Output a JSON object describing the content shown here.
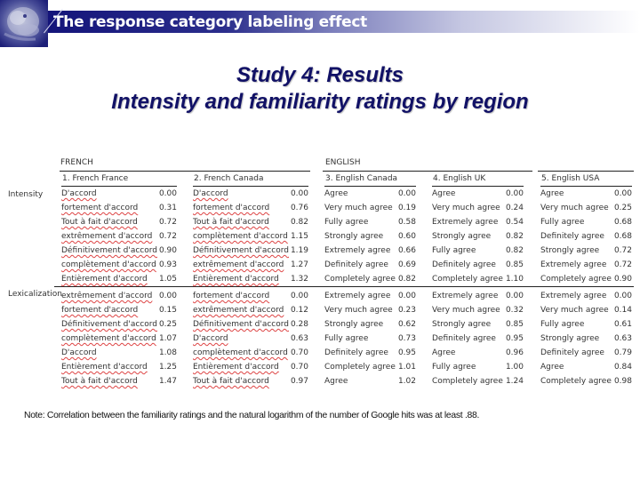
{
  "header": {
    "title": "The response category labeling effect",
    "logo_icon": "lion-icon"
  },
  "slide": {
    "title_line1": "Study 4: Results",
    "title_line2": "Intensity and familiarity ratings by region"
  },
  "table": {
    "groups": [
      {
        "label": "FRENCH"
      },
      {
        "label": "ENGLISH"
      },
      {
        "label": ""
      }
    ],
    "sections": [
      "Intensity",
      "Lexicalization"
    ],
    "columns": [
      {
        "header": "1. French France",
        "intensity": [
          {
            "label": "D'accord",
            "value": "0.00"
          },
          {
            "label": "fortement d'accord",
            "value": "0.31"
          },
          {
            "label": "Tout à fait d'accord",
            "value": "0.72"
          },
          {
            "label": "extrêmement d'accord",
            "value": "0.72"
          },
          {
            "label": "Définitivement d'accord",
            "value": "0.90"
          },
          {
            "label": "complètement d'accord",
            "value": "0.93"
          },
          {
            "label": "Entièrement d'accord",
            "value": "1.05"
          }
        ],
        "lexicalization": [
          {
            "label": "extrêmement d'accord",
            "value": "0.00"
          },
          {
            "label": "fortement d'accord",
            "value": "0.15"
          },
          {
            "label": "Définitivement d'accord",
            "value": "0.25"
          },
          {
            "label": "complètement d'accord",
            "value": "1.07"
          },
          {
            "label": "D'accord",
            "value": "1.08"
          },
          {
            "label": "Entièrement d'accord",
            "value": "1.25"
          },
          {
            "label": "Tout à fait d'accord",
            "value": "1.47"
          }
        ]
      },
      {
        "header": "2. French Canada",
        "intensity": [
          {
            "label": "D'accord",
            "value": "0.00"
          },
          {
            "label": "fortement d'accord",
            "value": "0.76"
          },
          {
            "label": "Tout à fait d'accord",
            "value": "0.82"
          },
          {
            "label": "complètement d'accord",
            "value": "1.15"
          },
          {
            "label": "Définitivement d'accord",
            "value": "1.19"
          },
          {
            "label": "extrêmement d'accord",
            "value": "1.27"
          },
          {
            "label": "Entièrement d'accord",
            "value": "1.32"
          }
        ],
        "lexicalization": [
          {
            "label": "fortement d'accord",
            "value": "0.00"
          },
          {
            "label": "extrêmement d'accord",
            "value": "0.12"
          },
          {
            "label": "Définitivement d'accord",
            "value": "0.28"
          },
          {
            "label": "D'accord",
            "value": "0.63"
          },
          {
            "label": "complètement d'accord",
            "value": "0.70"
          },
          {
            "label": "Entièrement d'accord",
            "value": "0.70"
          },
          {
            "label": "Tout à fait d'accord",
            "value": "0.97"
          }
        ]
      },
      {
        "header": "3. English Canada",
        "intensity": [
          {
            "label": "Agree",
            "value": "0.00"
          },
          {
            "label": "Very much agree",
            "value": "0.19"
          },
          {
            "label": "Fully agree",
            "value": "0.58"
          },
          {
            "label": "Strongly agree",
            "value": "0.60"
          },
          {
            "label": "Extremely agree",
            "value": "0.66"
          },
          {
            "label": "Definitely agree",
            "value": "0.69"
          },
          {
            "label": "Completely agree",
            "value": "0.82"
          }
        ],
        "lexicalization": [
          {
            "label": "Extremely agree",
            "value": "0.00"
          },
          {
            "label": "Very much agree",
            "value": "0.23"
          },
          {
            "label": "Strongly agree",
            "value": "0.62"
          },
          {
            "label": "Fully agree",
            "value": "0.73"
          },
          {
            "label": "Definitely agree",
            "value": "0.95"
          },
          {
            "label": "Completely agree",
            "value": "1.01"
          },
          {
            "label": "Agree",
            "value": "1.02"
          }
        ]
      },
      {
        "header": "4. English UK",
        "intensity": [
          {
            "label": "Agree",
            "value": "0.00"
          },
          {
            "label": "Very much agree",
            "value": "0.24"
          },
          {
            "label": "Extremely agree",
            "value": "0.54"
          },
          {
            "label": "Strongly agree",
            "value": "0.82"
          },
          {
            "label": "Fully agree",
            "value": "0.82"
          },
          {
            "label": "Definitely agree",
            "value": "0.85"
          },
          {
            "label": "Completely agree",
            "value": "1.10"
          }
        ],
        "lexicalization": [
          {
            "label": "Extremely agree",
            "value": "0.00"
          },
          {
            "label": "Very much agree",
            "value": "0.32"
          },
          {
            "label": "Strongly agree",
            "value": "0.85"
          },
          {
            "label": "Definitely agree",
            "value": "0.95"
          },
          {
            "label": "Agree",
            "value": "0.96"
          },
          {
            "label": "Fully agree",
            "value": "1.00"
          },
          {
            "label": "Completely agree",
            "value": "1.24"
          }
        ]
      },
      {
        "header": "5. English USA",
        "intensity": [
          {
            "label": "Agree",
            "value": "0.00"
          },
          {
            "label": "Very much agree",
            "value": "0.25"
          },
          {
            "label": "Fully agree",
            "value": "0.68"
          },
          {
            "label": "Definitely agree",
            "value": "0.68"
          },
          {
            "label": "Strongly agree",
            "value": "0.72"
          },
          {
            "label": "Extremely agree",
            "value": "0.72"
          },
          {
            "label": "Completely agree",
            "value": "0.90"
          }
        ],
        "lexicalization": [
          {
            "label": "Extremely agree",
            "value": "0.00"
          },
          {
            "label": "Very much agree",
            "value": "0.14"
          },
          {
            "label": "Fully agree",
            "value": "0.61"
          },
          {
            "label": "Strongly agree",
            "value": "0.63"
          },
          {
            "label": "Definitely agree",
            "value": "0.79"
          },
          {
            "label": "Agree",
            "value": "0.84"
          },
          {
            "label": "Completely agree",
            "value": "0.98"
          }
        ]
      }
    ]
  },
  "note": "Note:  Correlation between the familiarity ratings and the natural logarithm of the number of Google hits was at least .88."
}
